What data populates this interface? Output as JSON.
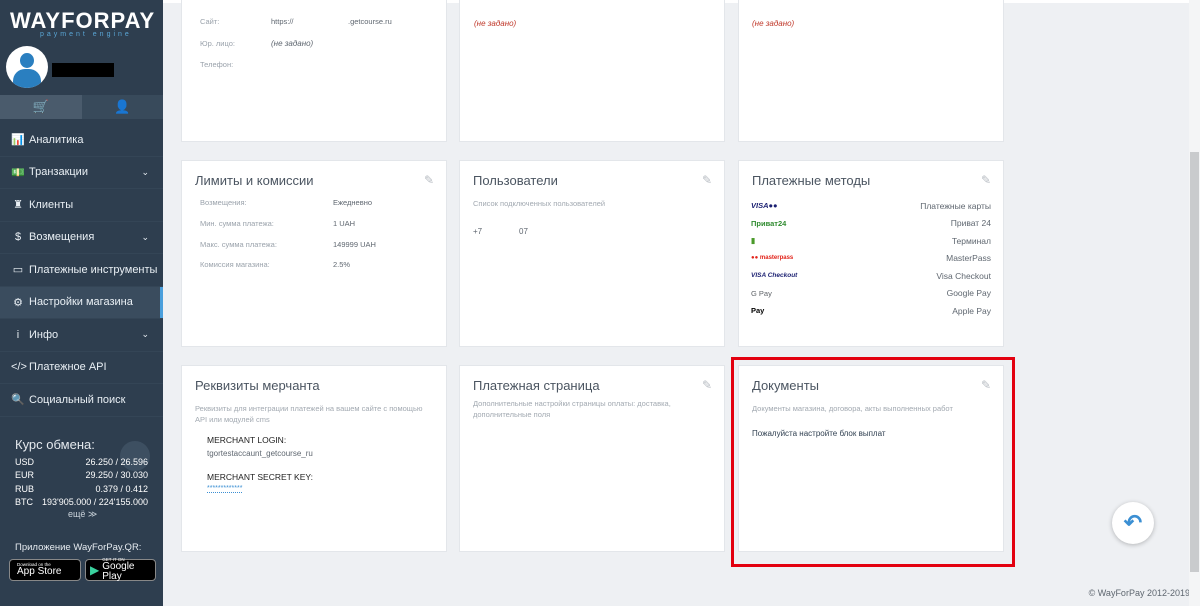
{
  "sidebar": {
    "logo": "WAYFORPAY",
    "logo_sub": "payment engine",
    "tabs": [
      {
        "icon": "basket-icon",
        "glyph": "🛒"
      },
      {
        "icon": "user-icon",
        "glyph": "👤"
      }
    ],
    "nav": [
      {
        "label": "Аналитика",
        "icon": "chart-icon",
        "glyph": "📊",
        "has_chevron": false
      },
      {
        "label": "Транзакции",
        "icon": "money-icon",
        "glyph": "💵",
        "has_chevron": true
      },
      {
        "label": "Клиенты",
        "icon": "clients-icon",
        "glyph": "♜",
        "has_chevron": false
      },
      {
        "label": "Возмещения",
        "icon": "dollar-icon",
        "glyph": "$",
        "has_chevron": true
      },
      {
        "label": "Платежные инструменты",
        "icon": "card-icon",
        "glyph": "▭",
        "has_chevron": false
      },
      {
        "label": "Настройки магазина",
        "icon": "gear-icon",
        "glyph": "⚙",
        "has_chevron": false,
        "active": true
      },
      {
        "label": "Инфо",
        "icon": "info-icon",
        "glyph": "i",
        "has_chevron": true
      },
      {
        "label": "Платежное API",
        "icon": "code-icon",
        "glyph": "</>",
        "has_chevron": false
      },
      {
        "label": "Социальный поиск",
        "icon": "search-icon",
        "glyph": "🔍",
        "has_chevron": false
      }
    ],
    "rates_title": "Курс обмена:",
    "rates": [
      {
        "cur": "USD",
        "val": "26.250 / 26.596"
      },
      {
        "cur": "EUR",
        "val": "29.250 / 30.030"
      },
      {
        "cur": "RUB",
        "val": "0.379 / 0.412"
      },
      {
        "cur": "BTC",
        "val": "193'905.000 / 224'155.000"
      }
    ],
    "more": "ещё ≫",
    "app_title": "Приложение WayForPay.QR:",
    "appstore_small": "Download on the",
    "appstore_big": "App Store",
    "gplay_small": "GET IT ON",
    "gplay_big": "Google Play"
  },
  "store_card": {
    "site_label": "Сайт:",
    "site_value_a": "https://",
    "site_value_b": ".getcourse.ru",
    "legal_label": "Юр. лицо:",
    "legal_value": "(не задано)",
    "phone_label": "Телефон:"
  },
  "card_top_mid": {
    "value": "(не задано)"
  },
  "card_top_right": {
    "value": "(не задано)"
  },
  "limits": {
    "title": "Лимиты и комиссии",
    "rows": [
      {
        "k": "Возмещения:",
        "v": "Ежедневно"
      },
      {
        "k": "Мин. сумма платежа:",
        "v": "1 UAH"
      },
      {
        "k": "Макс. сумма платежа:",
        "v": "149999 UAH"
      },
      {
        "k": "Комиссия магазина:",
        "v": "2.5%"
      }
    ]
  },
  "users": {
    "title": "Пользователи",
    "subtitle": "Список подключенных пользователей",
    "phone_a": "+7",
    "phone_b": "07"
  },
  "payment_methods": {
    "title": "Платежные методы",
    "rows": [
      {
        "logo": "VISA●●",
        "label": "Платежные карты",
        "color": "#1a1f71"
      },
      {
        "logo": "Приват24",
        "label": "Приват 24",
        "color": "#2f8b2f"
      },
      {
        "logo": "▮",
        "label": "Терминал",
        "color": "#4a9a2a"
      },
      {
        "logo": "●● masterpass",
        "label": "MasterPass",
        "color": "#e2231a"
      },
      {
        "logo": "VISA Checkout",
        "label": "Visa Checkout",
        "color": "#1a1f71"
      },
      {
        "logo": "G Pay",
        "label": "Google Pay",
        "color": "#5f6368"
      },
      {
        "logo": " Pay",
        "label": "Apple Pay",
        "color": "#000000"
      }
    ]
  },
  "merchant": {
    "title": "Реквизиты мерчанта",
    "desc": "Реквизиты для интеграции платежей на вашем сайте с помощью API или модулей cms",
    "login_label": "MERCHANT LOGIN:",
    "login_value": "tgortestaccaunt_getcourse_ru",
    "key_label": "MERCHANT SECRET KEY:",
    "key_value": "*************"
  },
  "payment_page": {
    "title": "Платежная страница",
    "desc": "Дополнительные настройки страницы оплаты: доставка, дополнительные поля"
  },
  "documents": {
    "title": "Документы",
    "desc": "Документы магазина, договора, акты выполненных работ",
    "link": "Пожалуйста настройте блок выплат"
  },
  "footer": "© WayForPay 2012-2019",
  "colors": {
    "sidebar": "#2e3e4f",
    "accent": "#4a9fdc",
    "highlight": "#e3000f"
  }
}
